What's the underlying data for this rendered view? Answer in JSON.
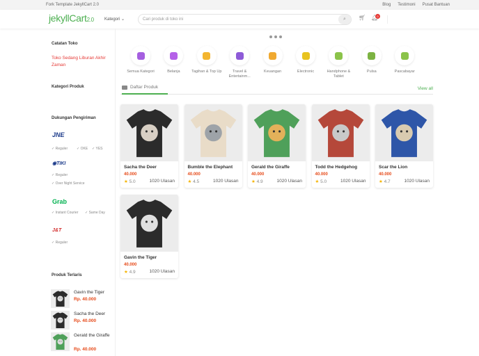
{
  "topbar": {
    "left": "Fork Template JekyllCart 2.0",
    "links": [
      "Blog",
      "Testimoni",
      "Pusat Bantuan"
    ]
  },
  "header": {
    "logo": "jekyllCart",
    "logo_version": "2.0",
    "kategori": "Kategori ⌄",
    "search_placeholder": "Cari produk di toko ini",
    "notif_count": "0"
  },
  "sidebar": {
    "catatan_title": "Catatan Toko",
    "catatan_text": "Toko Sedang Liburan Akhir Zaman",
    "kategori_title": "Kategori Produk",
    "shipping_title": "Dukungan Pengiriman",
    "couriers": [
      {
        "name": "JNE",
        "services": [
          "Reguler",
          "OKE",
          "YES"
        ]
      },
      {
        "name": "TIKI",
        "services": [
          "Reguler",
          "Over Night Service"
        ]
      },
      {
        "name": "Grab",
        "services": [
          "Instant Courier",
          "Same Day"
        ]
      },
      {
        "name": "J&T",
        "services": [
          "Reguler"
        ]
      }
    ],
    "best_title": "Produk Terlaris",
    "best": [
      {
        "name": "Gavin the Tiger",
        "price": "Rp. 40.000",
        "color": "#2b2b2b"
      },
      {
        "name": "Sacha the Deer",
        "price": "Rp. 40.000",
        "color": "#2b2b2b"
      },
      {
        "name": "Gerald the Giraffe",
        "price": "Rp. 40.000",
        "color": "#4fa05a"
      }
    ]
  },
  "categories": [
    {
      "label": "Semua Kategori",
      "color": "#a55fe0"
    },
    {
      "label": "Belanja",
      "color": "#b561e8"
    },
    {
      "label": "Tagihan & Top Up",
      "color": "#f3b530"
    },
    {
      "label": "Travel & Entertainm...",
      "color": "#8e5bd8"
    },
    {
      "label": "Keuangan",
      "color": "#f0a930"
    },
    {
      "label": "Electronic",
      "color": "#e8c320"
    },
    {
      "label": "Handphone & Tablet",
      "color": "#8bc34a"
    },
    {
      "label": "Pulsa",
      "color": "#7cb342"
    },
    {
      "label": "Pascabayar",
      "color": "#8bc34a"
    }
  ],
  "tab": {
    "label": "Daftar Produk",
    "view_all": "View all"
  },
  "products": [
    {
      "name": "Sacha the Deer",
      "price": "40.000",
      "rating": "5.0",
      "reviews": "1020 Ulasan",
      "shirt": "#2b2b2b",
      "animal": "#d8cfc4"
    },
    {
      "name": "Bumble the Elephant",
      "price": "40.000",
      "rating": "4.5",
      "reviews": "1020 Ulasan",
      "shirt": "#e9dcc8",
      "animal": "#9ea3a8"
    },
    {
      "name": "Gerald the Giraffe",
      "price": "40.000",
      "rating": "4.9",
      "reviews": "1020 Ulasan",
      "shirt": "#4fa05a",
      "animal": "#e3b15a"
    },
    {
      "name": "Todd the Hedgehog",
      "price": "40.000",
      "rating": "5.0",
      "reviews": "1020 Ulasan",
      "shirt": "#b5483a",
      "animal": "#c9c9c9"
    },
    {
      "name": "Scar the Lion",
      "price": "40.000",
      "rating": "4.7",
      "reviews": "1020 Ulasan",
      "shirt": "#2e56a8",
      "animal": "#d9cbb0"
    },
    {
      "name": "Gavin the Tiger",
      "price": "40.000",
      "rating": "4.9",
      "reviews": "1020 Ulasan",
      "shirt": "#2b2b2b",
      "animal": "#e0e0e0"
    }
  ]
}
